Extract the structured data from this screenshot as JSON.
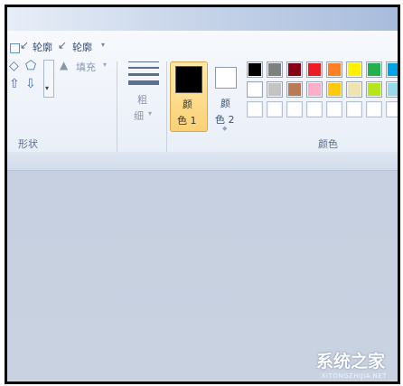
{
  "shapes_group": {
    "outline_label": "轮廓",
    "outline_label2": "轮廓",
    "fill_label": "填充",
    "group_title": "形状"
  },
  "size": {
    "label_line1": "粗",
    "label_line2": "细"
  },
  "color1": {
    "line1": "颜",
    "line2": "色 1",
    "value": "#000000"
  },
  "color2": {
    "line1": "颜",
    "line2": "色 2",
    "value": "#ffffff"
  },
  "colors_group": {
    "title": "颜色"
  },
  "palette": {
    "row1": [
      "#000000",
      "#7f7f7f",
      "#880015",
      "#ed1c24",
      "#ff7f27",
      "#fff200",
      "#22b14c",
      "#00a2e8"
    ],
    "row2": [
      "#ffffff",
      "#c3c3c3",
      "#b97a57",
      "#ffaec9",
      "#ffc90e",
      "#efe4b0",
      "#b5e61d",
      "#99d9ea"
    ],
    "row3": [
      "#ffffff",
      "#ffffff",
      "#ffffff",
      "#ffffff",
      "#ffffff",
      "#ffffff",
      "#ffffff",
      "#ffffff"
    ]
  },
  "watermark": {
    "text": "系统之家",
    "sub": "XITONGZHIJIA.NET"
  }
}
